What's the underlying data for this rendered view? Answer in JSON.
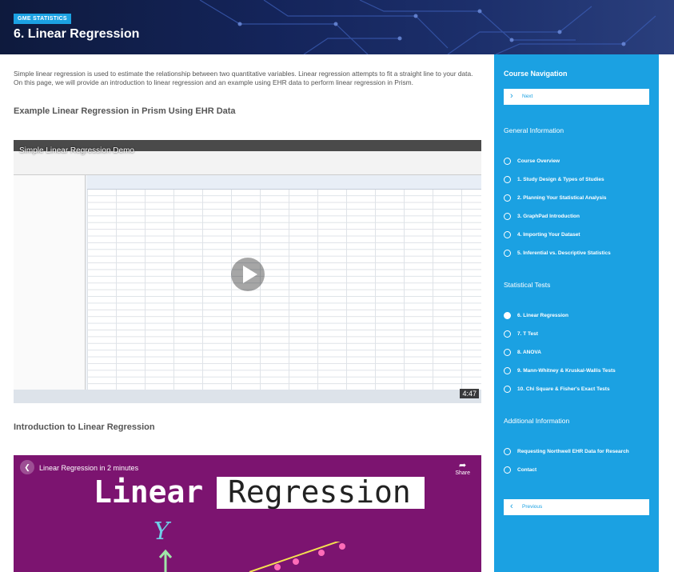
{
  "header": {
    "badge": "GME STATISTICS",
    "title": "6. Linear Regression"
  },
  "main": {
    "intro": "Simple linear regression is used to estimate the relationship between two quantitative variables. Linear regression attempts to fit a straight line to your data. On this page, we will provide an introduction to linear regression and an example using EHR data to perform linear regression in Prism.",
    "example_heading": "Example Linear Regression in Prism Using EHR Data",
    "video1": {
      "title": "Simple Linear Regression Demo",
      "duration": "4:47"
    },
    "intro_heading": "Introduction to Linear Regression",
    "video2": {
      "title": "Linear Regression in 2 minutes",
      "share": "Share",
      "big_word1": "Linear",
      "big_word2": "Regression",
      "axis_letter": "Y"
    }
  },
  "sidebar": {
    "nav_heading": "Course Navigation",
    "next_label": "Next",
    "previous_label": "Previous",
    "general_heading": "General Information",
    "general_items": [
      {
        "label": "Course Overview"
      },
      {
        "label": "1. Study Design & Types of Studies"
      },
      {
        "label": "2. Planning Your Statistical Analysis"
      },
      {
        "label": "3. GraphPad Introduction"
      },
      {
        "label": "4. Importing Your Dataset"
      },
      {
        "label": "5. Inferential vs. Descriptive Statistics"
      }
    ],
    "tests_heading": "Statistical Tests",
    "tests_items": [
      {
        "label": "6. Linear Regression",
        "active": true
      },
      {
        "label": "7. T Test"
      },
      {
        "label": "8. ANOVA"
      },
      {
        "label": "9. Mann-Whitney & Kruskal-Wallis Tests"
      },
      {
        "label": "10. Chi Square & Fisher's Exact Tests"
      }
    ],
    "additional_heading": "Additional Information",
    "additional_items": [
      {
        "label": "Requesting Northwell EHR Data for Research"
      },
      {
        "label": "Contact"
      }
    ]
  },
  "colors": {
    "accent": "#1ba1e2",
    "banner": "#14245a",
    "video2_bg": "#7c1470"
  }
}
